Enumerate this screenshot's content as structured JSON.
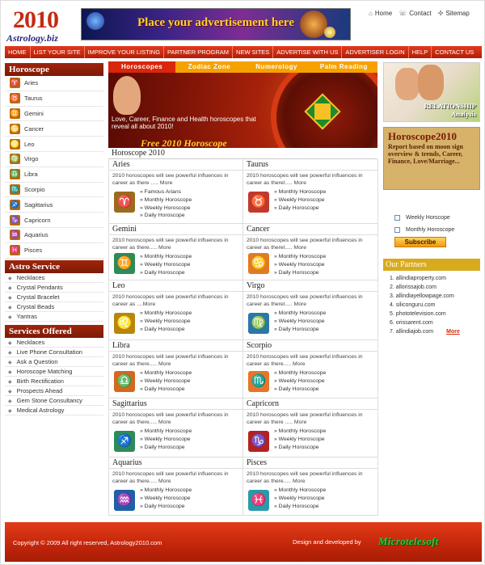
{
  "logo": {
    "year": "2010",
    "name": "Astrology.biz"
  },
  "ad_banner": {
    "text": "Place your advertisement here"
  },
  "top_links": {
    "home": "Home",
    "contact": "Contact",
    "sitemap": "Sitemap"
  },
  "nav": [
    "HOME",
    "LIST YOUR SITE",
    "IMPROVE YOUR LISTING",
    "PARTNER PROGRAM",
    "NEW SITES",
    "ADVERTISE WITH US",
    "ADVERTISER LOGIN",
    "HELP",
    "CONTACT US"
  ],
  "left": {
    "horoscope_title": "Horoscope",
    "signs": [
      "Aries",
      "Taurus",
      "Gemini",
      "Cancer",
      "Leo",
      "Virgo",
      "Libra",
      "Scorpio",
      "Sagittarius",
      "Capricorn",
      "Aquarius",
      "Pisces"
    ],
    "astro_title": "Astro Service",
    "astro_items": [
      "Necklaces",
      "Crystal Pendants",
      "Crystal Bracelet",
      "Crystal Beads",
      "Yantras"
    ],
    "services_title": "Services Offered",
    "services_items": [
      "Necklaces",
      "Live Phone Consultation",
      "Ask a Question",
      "Horoscope Matching",
      "Birth Rectification",
      "Prospects Ahead",
      "Gem Stone Consultancy",
      "Medical Astrology"
    ]
  },
  "center": {
    "tabs": [
      "Horoscopes",
      "Zodiac Zone",
      "Numerology",
      "Palm Reading"
    ],
    "banner_text": "Love, Career, Finance and Health horoscopes that reveal all about 2010!",
    "banner_free": "Free 2010 Horoscope",
    "section_title": "Horoscope 2010",
    "cards": [
      {
        "name": "Aries",
        "desc": "2010 horoscopes will see powerful influences in career as there ..... More",
        "links": [
          "» Famous Arians",
          "» Monthly Horoscope",
          "» Weekly Horoscope",
          "» Daily Horoscope"
        ]
      },
      {
        "name": "Taurus",
        "desc": "2010 horoscopes will see powerful influences in career as therel..... More",
        "links": [
          "» Monthly Horoscope",
          "» Weekly Horoscope",
          "» Daily Horoscope"
        ]
      },
      {
        "name": "Gemini",
        "desc": "2010 horoscopes will see powerful influences in career as there..... More",
        "links": [
          "» Monthly Horoscope",
          "» Weekly Horoscope",
          "» Daily Horoscope"
        ]
      },
      {
        "name": "Cancer",
        "desc": "2010 horoscopes will see powerful influences in career as therel..... More",
        "links": [
          "» Monthly Horoscope",
          "» Weekly Horoscope",
          "» Daily Horoscope"
        ]
      },
      {
        "name": "Leo",
        "desc": "2010 horoscopes will see powerful influences in career as ....More",
        "links": [
          "» Monthly Horoscope",
          "» Weekly Horoscope",
          "» Daily Horoscope"
        ]
      },
      {
        "name": "Virgo",
        "desc": "2010 horoscopes will see powerful influences in career as therel..... More",
        "links": [
          "» Monthly Horoscope",
          "» Weekly Horoscope",
          "» Daily Horoscope"
        ]
      },
      {
        "name": "Libra",
        "desc": "2010 horoscopes will see powerful influences in career as there..... More",
        "links": [
          "» Monthly Horoscope",
          "» Weekly Horoscope",
          "» Daily Horoscope"
        ]
      },
      {
        "name": "Scorpio",
        "desc": "2010 horoscopes will see powerful influences in career as there..... More",
        "links": [
          "» Monthly Horoscope",
          "» Weekly Horoscope",
          "» Daily Horoscope"
        ]
      },
      {
        "name": "Sagittarius",
        "desc": "2010 horoscopes will see powerful influences in career as there..... More",
        "links": [
          "» Monthly Horoscope",
          "» Weekly Horoscope",
          "» Daily Horoscope"
        ]
      },
      {
        "name": "Capricorn",
        "desc": "2010 horoscopes will see powerful influences in career as there ..... More",
        "links": [
          "» Monthly Horoscope",
          "» Weekly Horoscope",
          "» Daily Horoscope"
        ]
      },
      {
        "name": "Aquarius",
        "desc": "2010 horoscopes will see powerful influences in career as there..... More",
        "links": [
          "» Monthly Horoscope",
          "» Weekly Horoscope",
          "» Daily Horoscope"
        ]
      },
      {
        "name": "Pisces",
        "desc": "2010 horoscopes will see powerful influences in career as there..... More",
        "links": [
          "» Monthly Horoscope",
          "» Weekly Horoscope",
          "» Daily Horoscope"
        ]
      }
    ]
  },
  "right": {
    "relationship": [
      "RELATIONSHIP",
      "Analysis"
    ],
    "h2010_title": "Horoscope2010",
    "h2010_desc": "Report based on moon sign overview & trends, Career, Finance, Love/Marriage...",
    "subscribe_options": [
      "Weekly Horscope",
      "Monthly Horoscope"
    ],
    "subscribe_label": "Subscribe",
    "partners_title": "Our Partners",
    "partners": [
      "allindiaproperty.com",
      "allorissajob.com",
      "allindiayellowpage.com",
      "siliconguru.com",
      "phototelevision.com",
      "orissarent.com",
      "allindiajob.com"
    ],
    "more": "More"
  },
  "footer": {
    "copyright": "Copyright © 2009 All right reserved, Astrology2010.com",
    "design": "Design and developed by",
    "developer": "Microtelesoft"
  },
  "colors": {
    "nav_red": "#c62a12",
    "accent_orange": "#f7a100",
    "section_brown": "#8a1f07",
    "partner_gold": "#d8ab1f"
  },
  "icons": {
    "home": "home-icon",
    "contact": "contact-icon",
    "sitemap": "sitemap-icon"
  }
}
